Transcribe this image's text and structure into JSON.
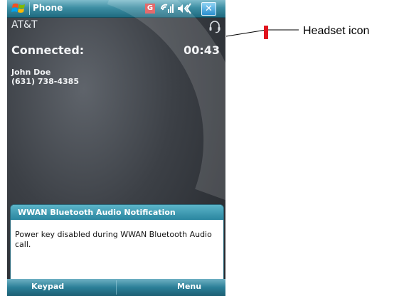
{
  "titlebar": {
    "app_title": "Phone",
    "gprs_label": "G",
    "close_label": "✕"
  },
  "call": {
    "carrier": "AT&T",
    "status": "Connected:",
    "timer": "00:43",
    "caller_name": "John Doe",
    "caller_number": "(631) 738-4385"
  },
  "notification": {
    "title": "WWAN Bluetooth Audio Notification",
    "message": "Power key disabled during WWAN Bluetooth Audio call."
  },
  "softkeys": {
    "left": "Keypad",
    "right": "Menu"
  },
  "callout": {
    "label": "Headset icon"
  },
  "colors": {
    "titlebar": "#2f8aa0",
    "callout_marker": "#e0141e"
  },
  "icons": [
    "windows-start-icon",
    "gprs-icon",
    "signal-icon",
    "volume-icon",
    "close-icon",
    "headset-icon"
  ]
}
